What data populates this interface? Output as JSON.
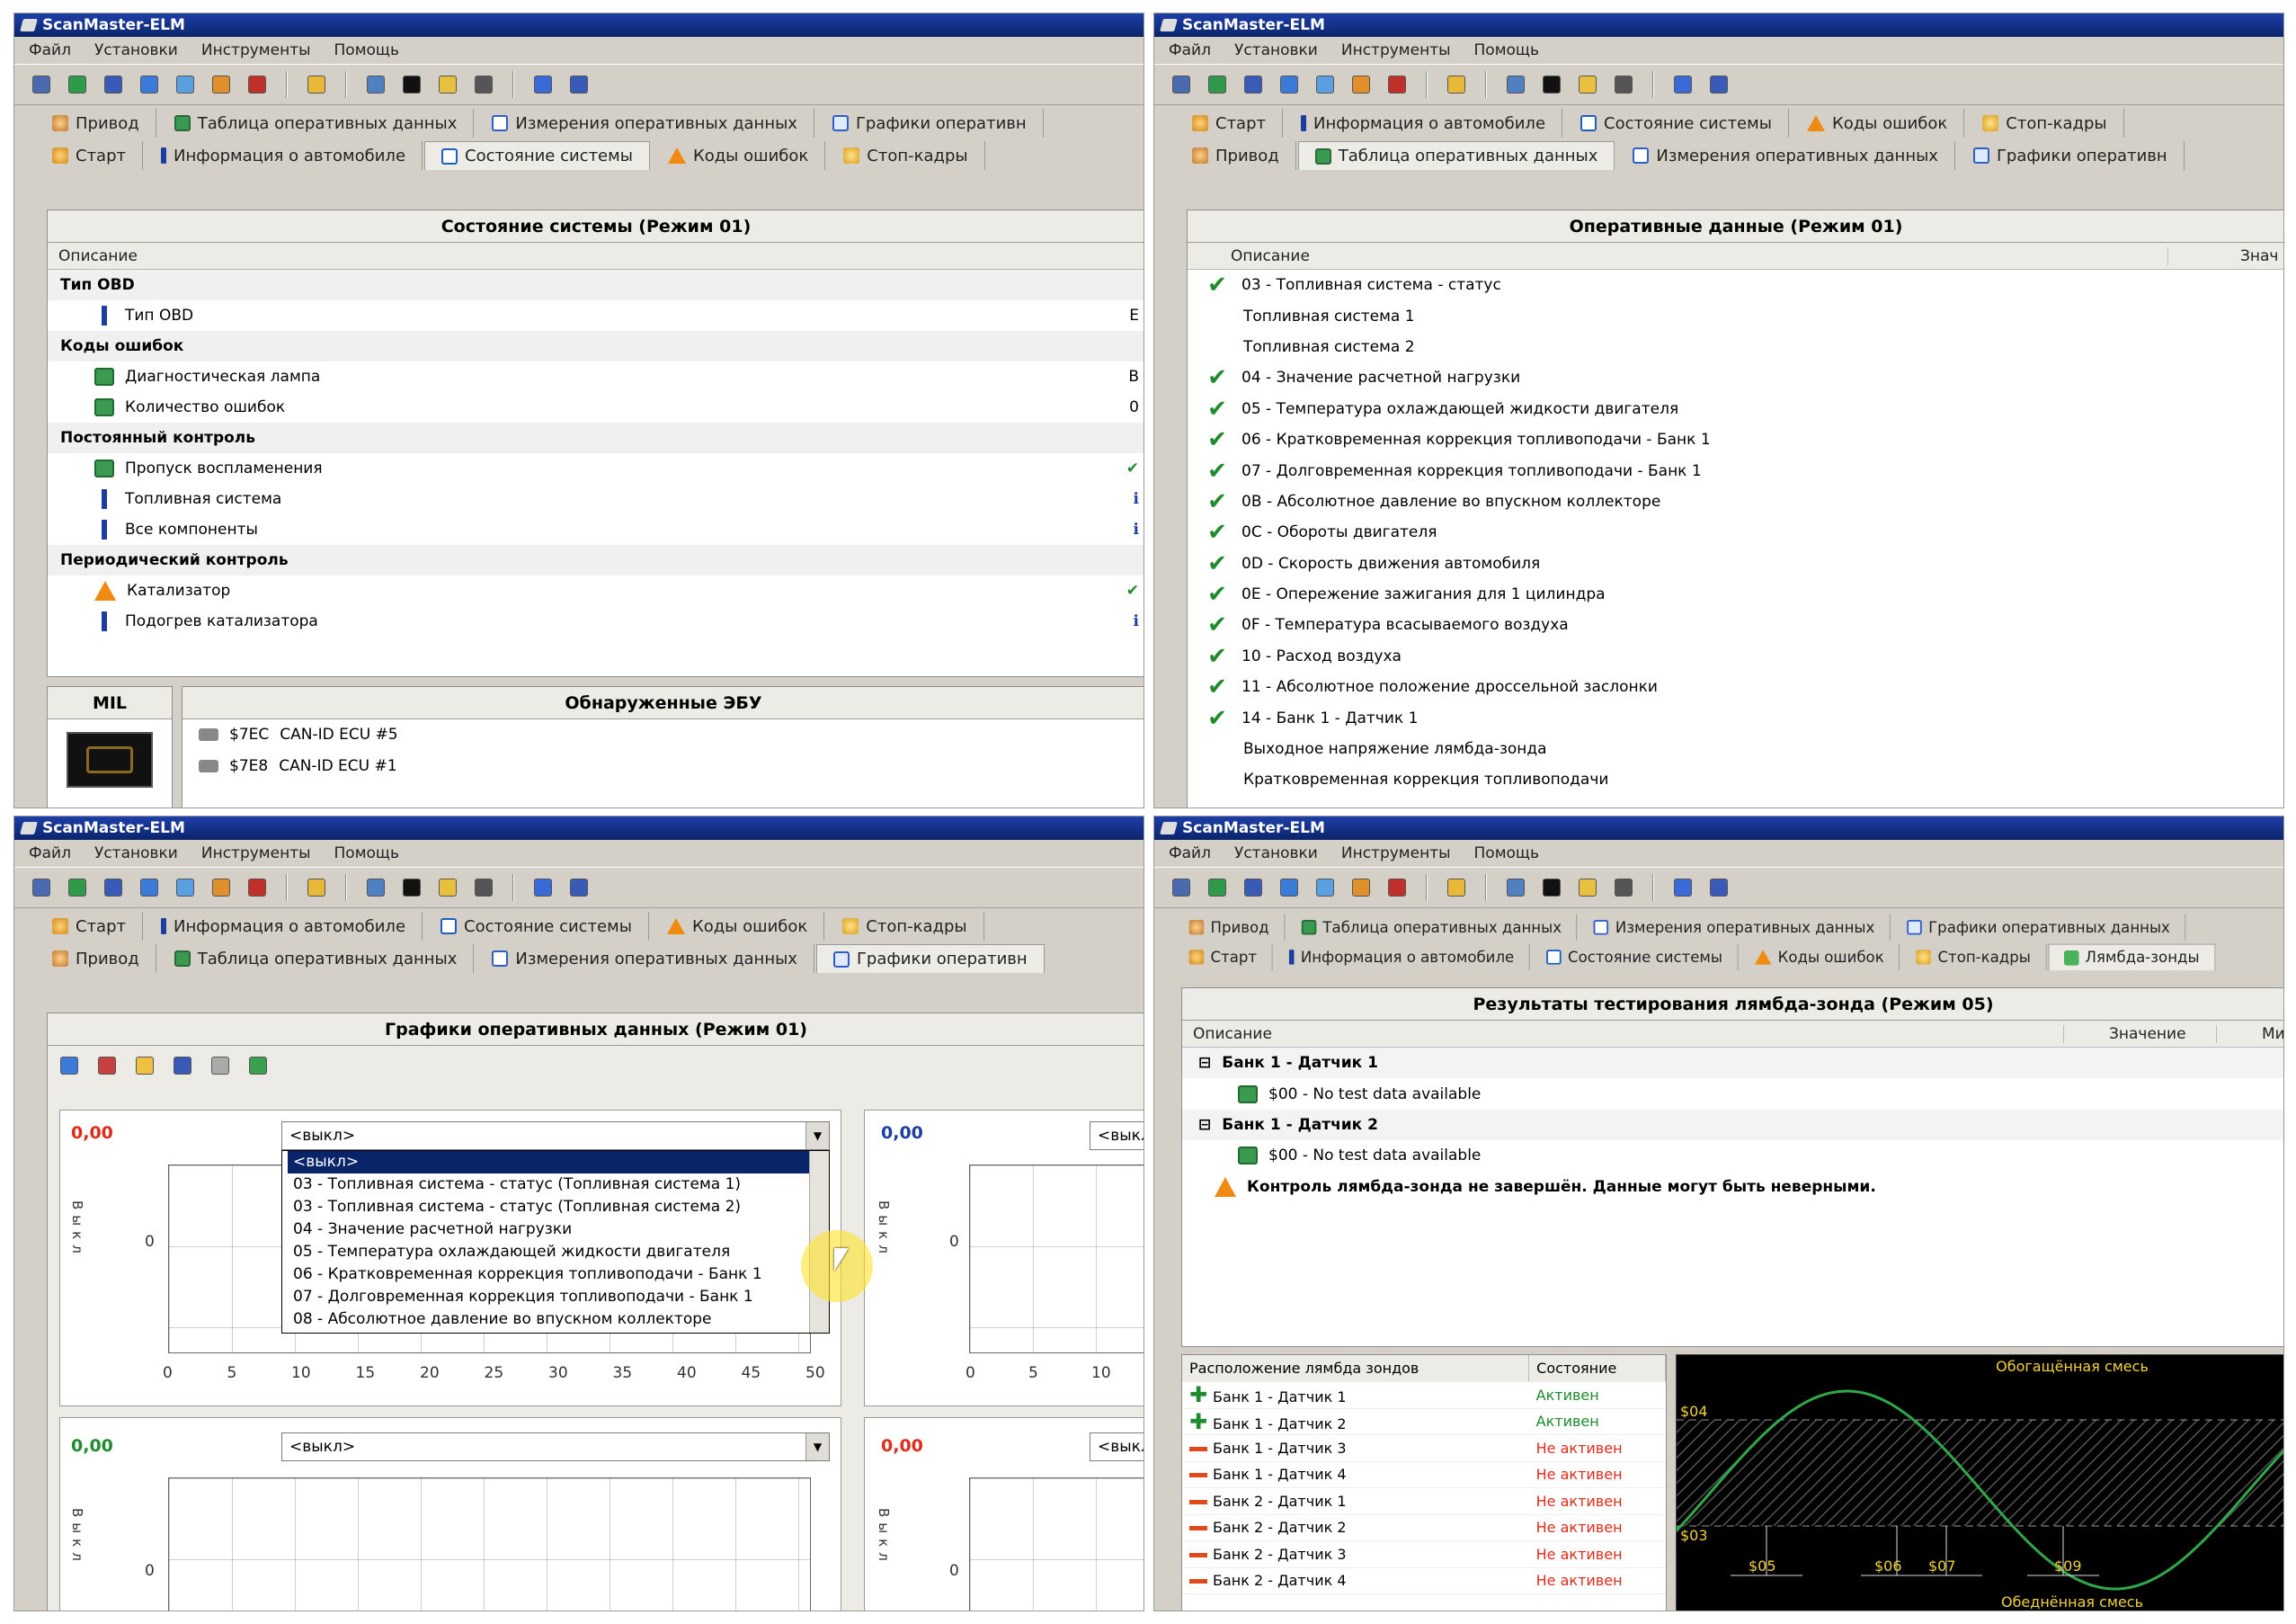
{
  "app_title": "ScanMaster-ELM",
  "menu": [
    "Файл",
    "Установки",
    "Инструменты",
    "Помощь"
  ],
  "tabs": {
    "start": "Старт",
    "info": "Информация о автомобиле",
    "state": "Состояние системы",
    "dtc": "Коды ошибок",
    "freeze": "Стоп-кадры",
    "drive": "Привод",
    "table": "Таблица оперативных данных",
    "meas": "Измерения оперативных данных",
    "graph": "Графики оперативн",
    "graph_full": "Графики оперативных данных",
    "lambda": "Лямбда-зонды"
  },
  "q1": {
    "panel_title": "Состояние системы (Режим 01)",
    "col_desc": "Описание",
    "groups": [
      {
        "label": "Тип OBD",
        "rows": [
          {
            "icon": "info-icon",
            "label": "Тип OBD",
            "value": "E"
          }
        ]
      },
      {
        "label": "Коды ошибок",
        "rows": [
          {
            "icon": "ok-icon",
            "label": "Диагностическая лампа",
            "value": "В"
          },
          {
            "icon": "ok-icon",
            "label": "Количество ошибок",
            "value": "0"
          }
        ]
      },
      {
        "label": "Постоянный контроль",
        "rows": [
          {
            "icon": "ok-icon",
            "label": "Пропуск воспламенения",
            "value": "✔"
          },
          {
            "icon": "info-icon",
            "label": "Топливная система",
            "value": "ℹ"
          },
          {
            "icon": "info-icon",
            "label": "Все компоненты",
            "value": "ℹ"
          }
        ]
      },
      {
        "label": "Периодический контроль",
        "rows": [
          {
            "icon": "warn-icon",
            "label": "Катализатор",
            "value": "✔"
          },
          {
            "icon": "info-icon",
            "label": "Подогрев катализатора",
            "value": "ℹ"
          }
        ]
      }
    ],
    "mil_label": "MIL",
    "ecu_title": "Обнаруженные ЭБУ",
    "ecus": [
      {
        "id": "$7EC",
        "name": "CAN-ID ECU #5"
      },
      {
        "id": "$7E8",
        "name": "CAN-ID ECU #1"
      }
    ]
  },
  "q2": {
    "panel_title": "Оперативные данные (Режим 01)",
    "col_desc": "Описание",
    "col_val": "Знач",
    "rows": [
      {
        "check": true,
        "label": "03 - Топливная система - статус"
      },
      {
        "check": false,
        "label": "Топливная система 1"
      },
      {
        "check": false,
        "label": "Топливная система 2"
      },
      {
        "check": true,
        "label": "04 - Значение расчетной нагрузки"
      },
      {
        "check": true,
        "label": "05 - Температура охлаждающей жидкости двигателя"
      },
      {
        "check": true,
        "label": "06 - Кратковременная коррекция топливоподачи - Банк 1"
      },
      {
        "check": true,
        "label": "07 - Долговременная коррекция топливоподачи - Банк 1"
      },
      {
        "check": true,
        "label": "0B - Абсолютное давление во впускном коллекторе"
      },
      {
        "check": true,
        "label": "0C - Обороты двигателя"
      },
      {
        "check": true,
        "label": "0D - Скорость движения автомобиля"
      },
      {
        "check": true,
        "label": "0E - Опережение зажигания для 1 цилиндра"
      },
      {
        "check": true,
        "label": "0F - Температура всасываемого воздуха"
      },
      {
        "check": true,
        "label": "10 - Расход воздуха"
      },
      {
        "check": true,
        "label": "11 - Абсолютное положение дроссельной заслонки"
      },
      {
        "check": true,
        "label": "14 - Банк 1 - Датчик 1"
      },
      {
        "check": false,
        "label": "Выходное напряжение лямбда-зонда"
      },
      {
        "check": false,
        "label": "Кратковременная коррекция топливоподачи"
      }
    ]
  },
  "q3": {
    "panel_title": "Графики оперативных данных (Режим 01)",
    "charts": [
      {
        "value": "0,00",
        "select": "<выкл>"
      },
      {
        "value": "0,00",
        "select": "<выкл>"
      },
      {
        "value": "0,00",
        "select": "<выкл>"
      },
      {
        "value": "0,00",
        "select": "<выкл>"
      }
    ],
    "dropdown": [
      "<выкл>",
      "03 - Топливная система - статус (Топливная система 1)",
      "03 - Топливная система - статус (Топливная система 2)",
      "04 - Значение расчетной нагрузки",
      "05 - Температура охлаждающей жидкости двигателя",
      "06 - Кратковременная коррекция топливоподачи - Банк 1",
      "07 - Долговременная коррекция топливоподачи - Банк 1",
      "08 - Абсолютное давление во впускном коллекторе"
    ],
    "y_label": "Выкл",
    "y_zero": "0",
    "x_ticks": [
      "0",
      "5",
      "10",
      "15",
      "20",
      "25",
      "30",
      "35",
      "40",
      "45",
      "50"
    ],
    "x_ticks_right": [
      "0",
      "5",
      "10"
    ]
  },
  "q4": {
    "panel_title": "Результаты тестирования лямбда-зонда (Режим 05)",
    "col_desc": "Описание",
    "col_val": "Значение",
    "col_extra": "Ми",
    "tree": [
      {
        "group": "Банк 1 - Датчик 1",
        "item": "$00 - No test data available"
      },
      {
        "group": "Банк 1 - Датчик 2",
        "item": "$00 - No test data available"
      }
    ],
    "warning": "Контроль лямбда-зонда не завершён. Данные могут быть неверными.",
    "sensor_table": {
      "col_location": "Расположение лямбда зондов",
      "col_state": "Состояние",
      "rows": [
        {
          "active": true,
          "label": "Банк 1 - Датчик 1",
          "state": "Активен"
        },
        {
          "active": true,
          "label": "Банк 1 - Датчик 2",
          "state": "Активен"
        },
        {
          "active": false,
          "label": "Банк 1 - Датчик 3",
          "state": "Не активен"
        },
        {
          "active": false,
          "label": "Банк 1 - Датчик 4",
          "state": "Не активен"
        },
        {
          "active": false,
          "label": "Банк 2 - Датчик 1",
          "state": "Не активен"
        },
        {
          "active": false,
          "label": "Банк 2 - Датчик 2",
          "state": "Не активен"
        },
        {
          "active": false,
          "label": "Банк 2 - Датчик 3",
          "state": "Не активен"
        },
        {
          "active": false,
          "label": "Банк 2 - Датчик 4",
          "state": "Не активен"
        }
      ]
    },
    "wave": {
      "rich": "Обогащённая смесь",
      "lean": "Обеднённая смесь",
      "labels": [
        "$04",
        "$03",
        "$05",
        "$06",
        "$07",
        "$09"
      ]
    }
  },
  "colors": {
    "active": "#1f8a2e",
    "inactive": "#e02a1a",
    "chart_value": "#e02a1a",
    "chart_value_blue": "#1b3ea0",
    "chart_value_green": "#1f8a2e",
    "wave_bg": "#000000",
    "wave_line": "#2fa84a",
    "wave_text": "#f2d23a"
  }
}
